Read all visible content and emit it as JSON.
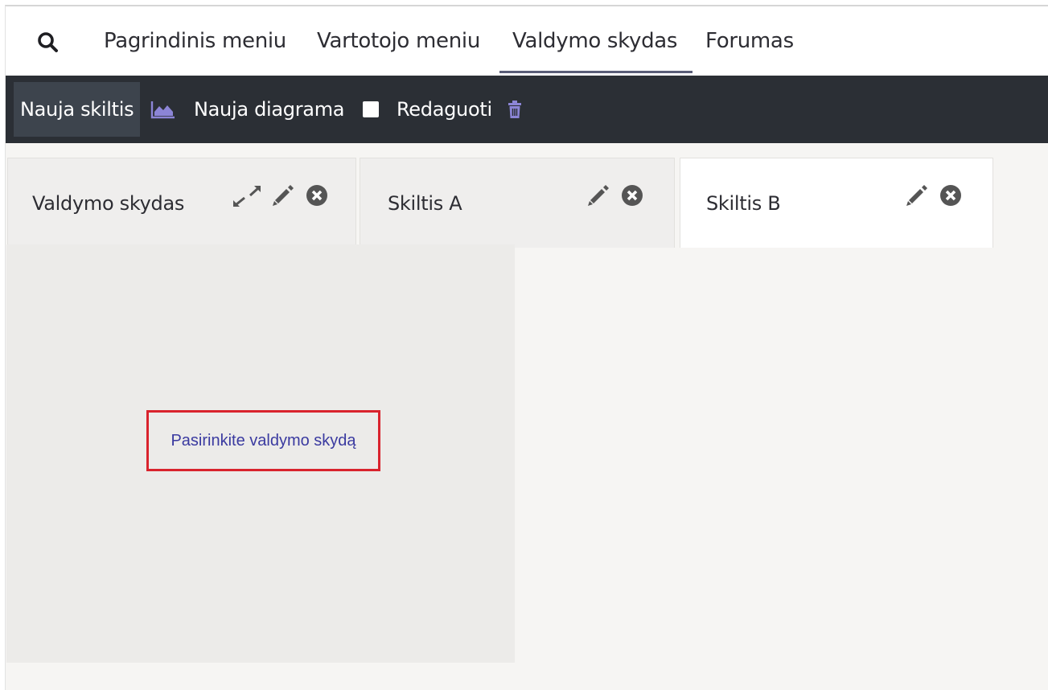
{
  "nav": {
    "items": [
      {
        "label": "Pagrindinis meniu"
      },
      {
        "label": "Vartotojo meniu"
      },
      {
        "label": "Valdymo skydas",
        "active": true
      },
      {
        "label": "Forumas"
      }
    ]
  },
  "toolbar": {
    "new_section_label": "Nauja skiltis",
    "new_chart_label": "Nauja diagrama",
    "edit_label": "Redaguoti",
    "edit_checked": false
  },
  "tabs": [
    {
      "label": "Valdymo skydas",
      "icons": [
        "expand-icon",
        "pencil-icon",
        "close-circle-icon"
      ]
    },
    {
      "label": "Skiltis A",
      "icons": [
        "pencil-icon",
        "close-circle-icon"
      ]
    },
    {
      "label": "Skiltis B",
      "icons": [
        "pencil-icon",
        "close-circle-icon"
      ],
      "selected": true
    }
  ],
  "content": {
    "placeholder_link": "Pasirinkite valdymo skydą"
  },
  "colors": {
    "toolbar_bg": "#2b2f35",
    "accent_icon": "#8c85d6",
    "highlight_border": "#d9232d",
    "link": "#3a3aa0"
  }
}
